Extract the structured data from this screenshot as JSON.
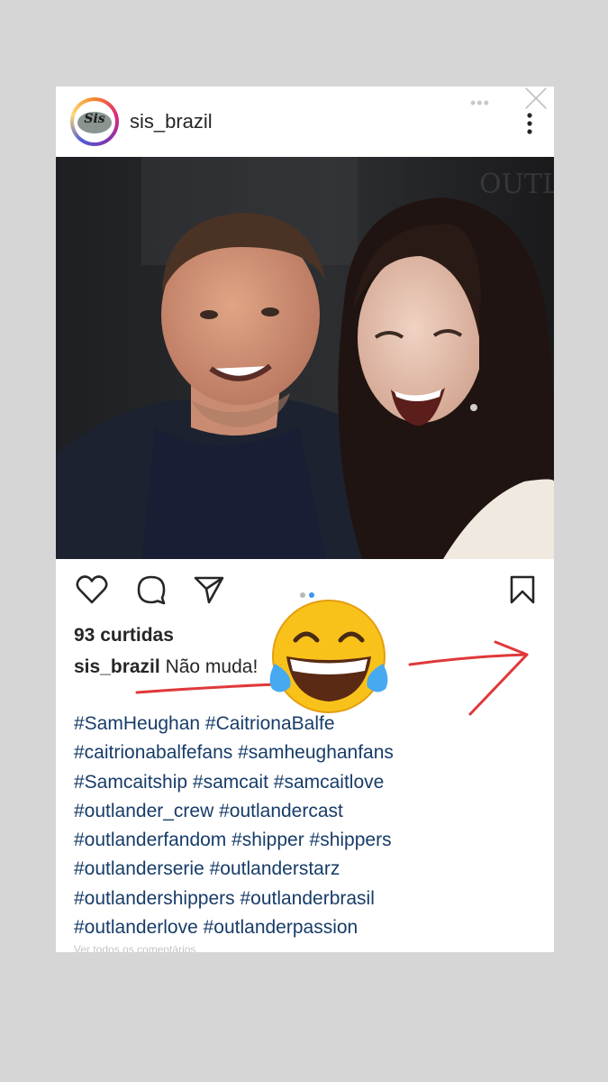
{
  "post": {
    "username": "sis_brazil",
    "avatar_text": "Sis",
    "overlay_dots": "•••",
    "likes": "93 curtidas",
    "caption_user": "sis_brazil",
    "caption_text": "Não muda!",
    "hashtag_lines": [
      "#SamHeughan #CaitrionaBalfe",
      "#caitrionabalfefans #samheughanfans",
      "#Samcaitship #samcait #samcaitlove",
      "#outlander_crew #outlandercast",
      "#outlanderfandom #shipper #shippers",
      "#outlanderserie #outlanderstarz",
      "#outlandershippers #outlanderbrasil",
      "#outlanderlove #outlanderpassion"
    ],
    "footer_faint": "Ver todos os comentários"
  },
  "icons": {
    "close": "close-icon",
    "more": "more-vertical-icon",
    "like": "heart-icon",
    "comment": "comment-icon",
    "share": "send-icon",
    "save": "bookmark-icon",
    "emoji": "tears-of-joy-emoji"
  },
  "colors": {
    "background": "#d6d6d6",
    "hashtag": "#173c68",
    "active_dot": "#3897f0",
    "annotation_red": "#e0383a"
  }
}
